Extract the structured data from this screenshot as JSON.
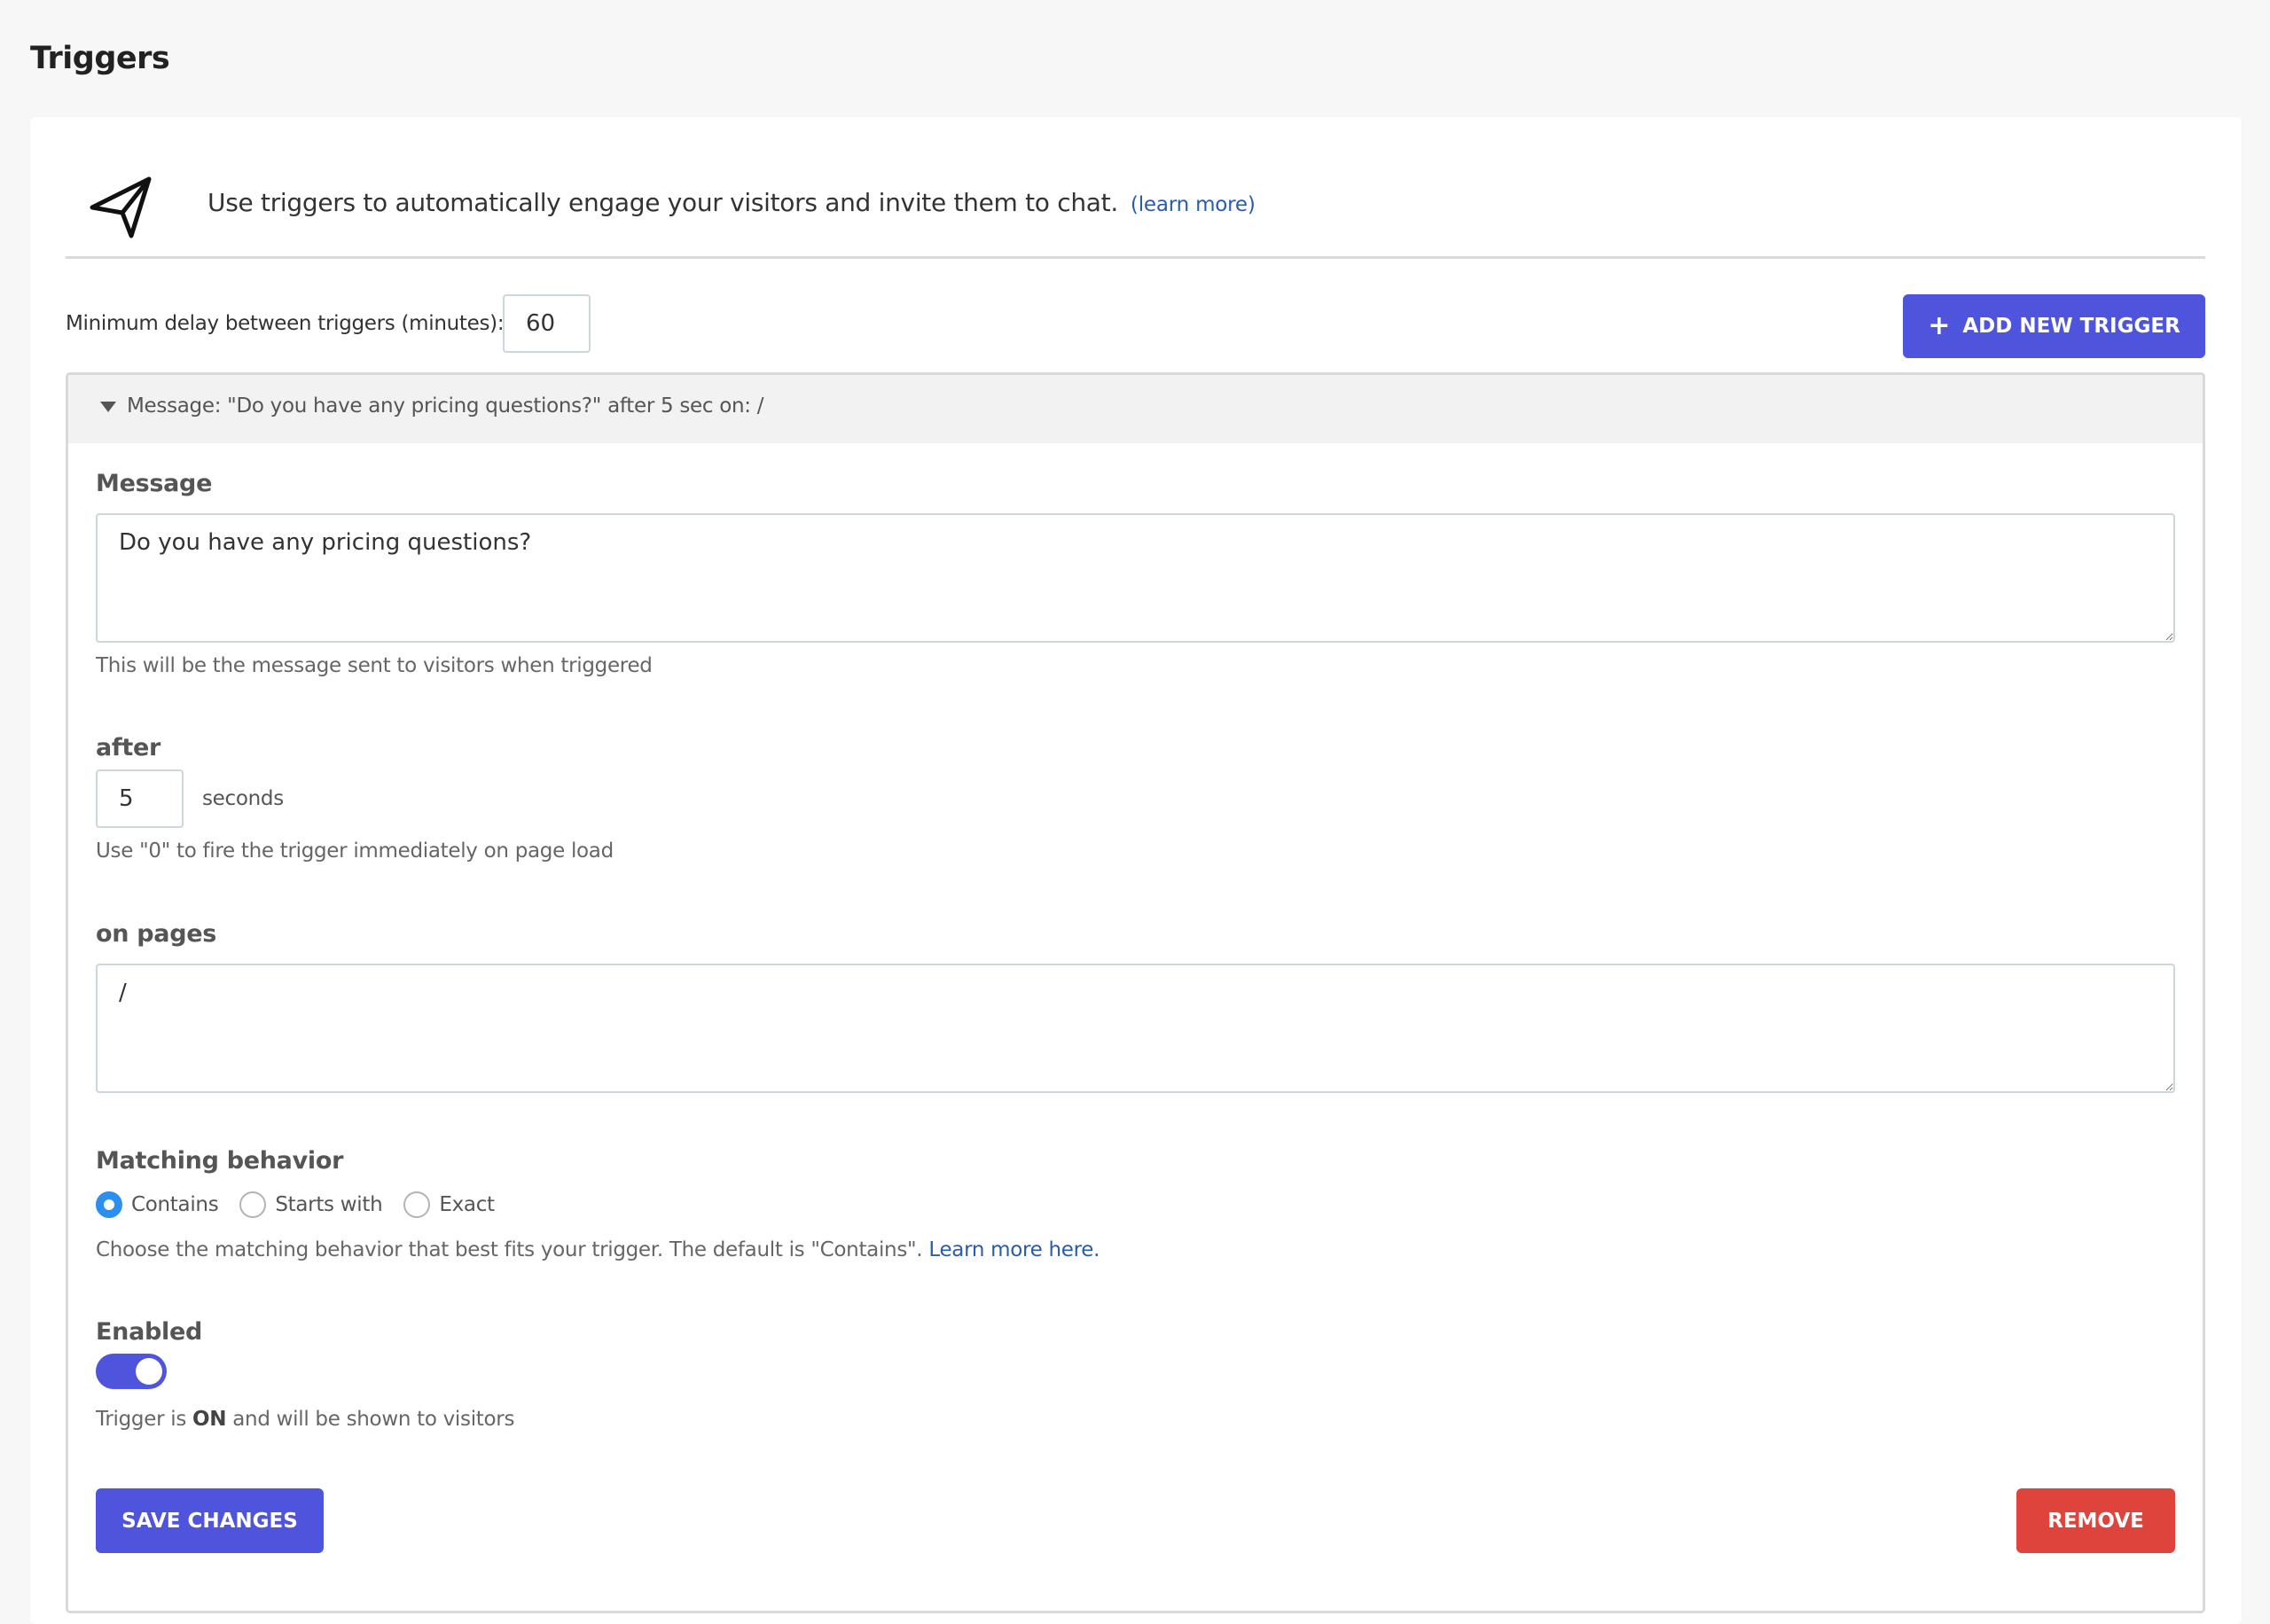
{
  "page": {
    "title": "Triggers"
  },
  "intro": {
    "icon": "send-icon",
    "text": "Use triggers to automatically engage your visitors and invite them to chat.",
    "link_label": "(learn more)"
  },
  "settings": {
    "min_delay_label": "Minimum delay between triggers (minutes):",
    "min_delay_value": "60",
    "add_button_icon": "plus-icon",
    "add_button_label": "ADD NEW TRIGGER"
  },
  "trigger": {
    "expanded": true,
    "summary": "Message: \"Do you have any pricing questions?\" after 5 sec on: /",
    "message": {
      "label": "Message",
      "value": "Do you have any pricing questions?",
      "help": "This will be the message sent to visitors when triggered"
    },
    "after": {
      "label": "after",
      "value": "5",
      "unit": "seconds",
      "help": "Use \"0\" to fire the trigger immediately on page load"
    },
    "pages": {
      "label": "on pages",
      "value": "/"
    },
    "matching": {
      "label": "Matching behavior",
      "options": [
        {
          "label": "Contains",
          "checked": true
        },
        {
          "label": "Starts with",
          "checked": false
        },
        {
          "label": "Exact",
          "checked": false
        }
      ],
      "help": "Choose the matching behavior that best fits your trigger. The default is \"Contains\".",
      "link_label": "Learn more here."
    },
    "enabled": {
      "label": "Enabled",
      "on": true,
      "status_prefix": "Trigger is",
      "status_value": "ON",
      "status_suffix": "and will be shown to visitors"
    },
    "save_label": "SAVE CHANGES",
    "remove_label": "REMOVE"
  },
  "colors": {
    "primary": "#4e54dc",
    "danger": "#de443c",
    "radio_checked": "#2b8ff0",
    "link": "#2a5caa"
  }
}
